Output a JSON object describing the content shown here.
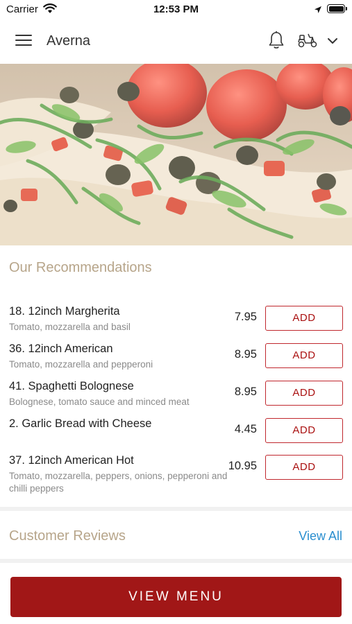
{
  "status_bar": {
    "carrier": "Carrier",
    "time": "12:53 PM",
    "icons": [
      "wifi-icon",
      "location-arrow-icon",
      "battery-icon"
    ]
  },
  "header": {
    "title": "Averna",
    "icons": [
      "hamburger-menu-icon",
      "bell-icon",
      "scooter-icon",
      "chevron-down-icon"
    ]
  },
  "hero": {
    "image": "pizza-with-tomatoes-olives-arugula"
  },
  "recommendations": {
    "title": "Our Recommendations",
    "items": [
      {
        "name": "18. 12inch Margherita",
        "description": "Tomato, mozzarella and basil",
        "price": "7.95",
        "button": "ADD"
      },
      {
        "name": "36. 12inch American",
        "description": "Tomato, mozzarella and pepperoni",
        "price": "8.95",
        "button": "ADD"
      },
      {
        "name": "41. Spaghetti Bolognese",
        "description": "Bolognese, tomato sauce and minced meat",
        "price": "8.95",
        "button": "ADD"
      },
      {
        "name": "2. Garlic Bread with Cheese",
        "description": "",
        "price": "4.45",
        "button": "ADD"
      },
      {
        "name": "37. 12inch American Hot",
        "description": "Tomato, mozzarella, peppers, onions, pepperoni and chilli peppers",
        "price": "10.95",
        "button": "ADD"
      }
    ]
  },
  "reviews": {
    "title": "Customer Reviews",
    "link": "View All"
  },
  "footer": {
    "button": "VIEW MENU"
  },
  "colors": {
    "accent": "#a11717",
    "heading": "#b7a58a",
    "link": "#2a8ecf"
  }
}
